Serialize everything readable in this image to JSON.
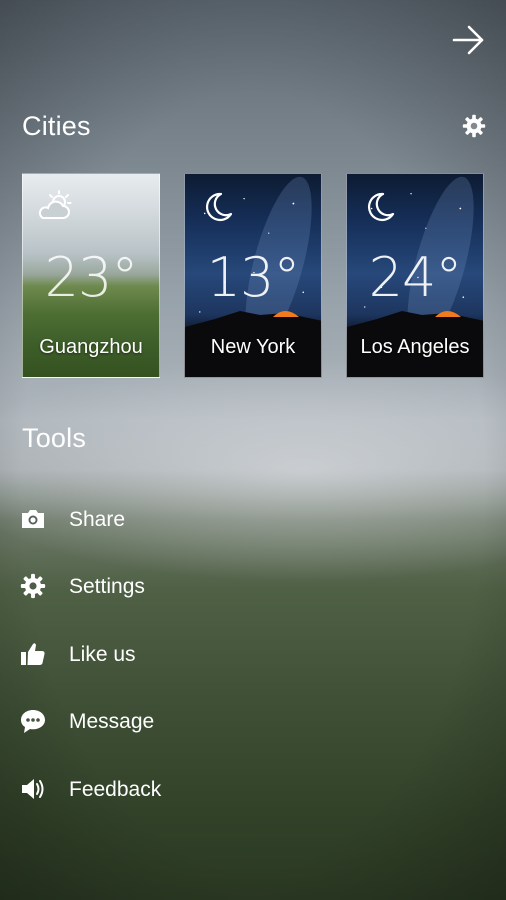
{
  "header": {
    "forward_icon": "arrow-right-icon"
  },
  "cities": {
    "title": "Cities",
    "settings_icon": "gear-icon",
    "items": [
      {
        "name": "Guangzhou",
        "temp": "23°",
        "condition_icon": "partly-cloudy-sun-icon"
      },
      {
        "name": "New York",
        "temp": "13°",
        "condition_icon": "moon-icon"
      },
      {
        "name": "Los Angeles",
        "temp": "24°",
        "condition_icon": "moon-icon"
      }
    ]
  },
  "tools": {
    "title": "Tools",
    "items": [
      {
        "label": "Share",
        "icon": "camera-icon"
      },
      {
        "label": "Settings",
        "icon": "gear-icon"
      },
      {
        "label": "Like us",
        "icon": "thumbs-up-icon"
      },
      {
        "label": "Message",
        "icon": "chat-bubble-icon"
      },
      {
        "label": "Feedback",
        "icon": "speaker-icon"
      }
    ]
  }
}
